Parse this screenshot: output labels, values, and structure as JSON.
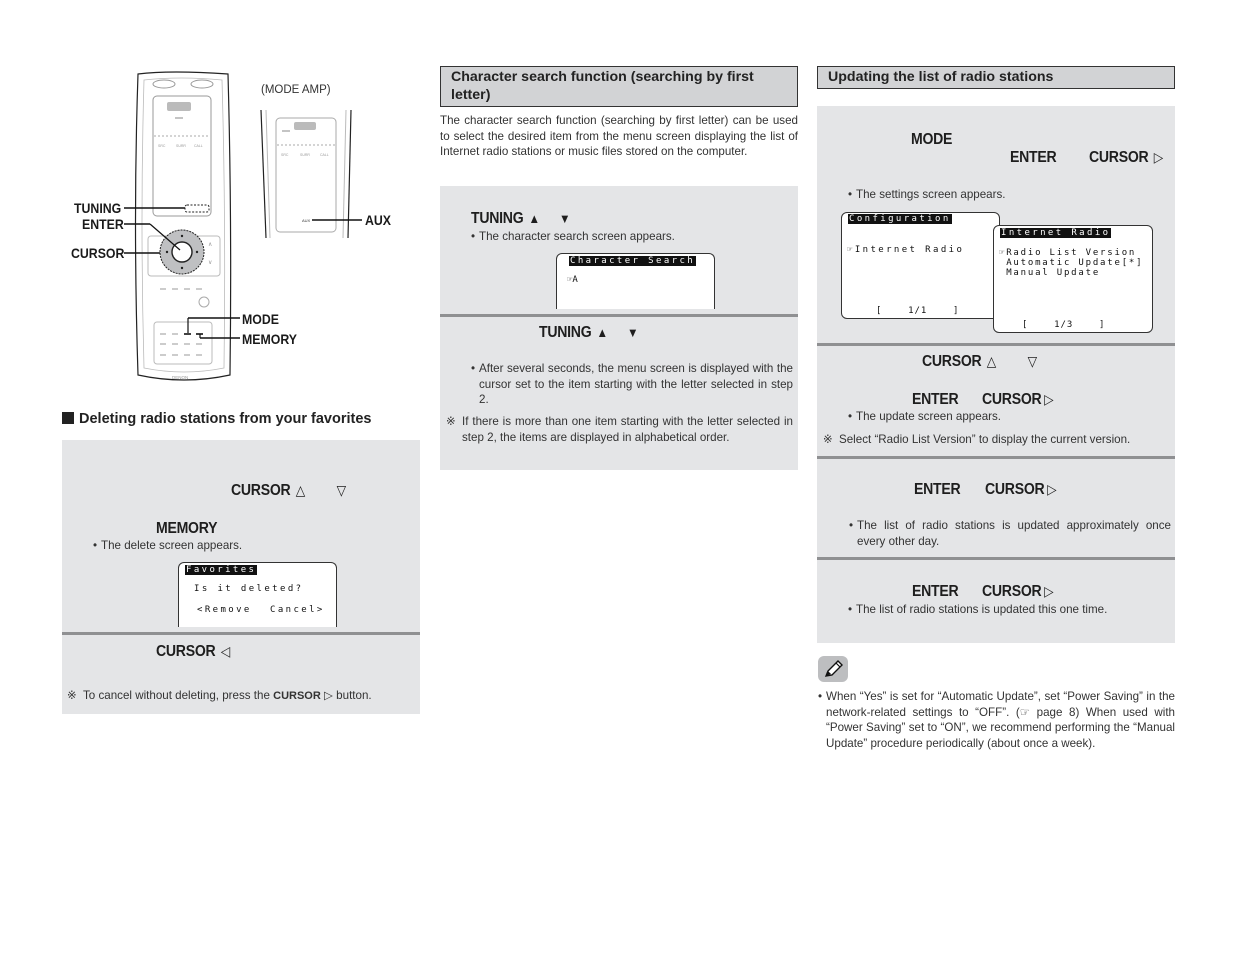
{
  "figure": {
    "remote_labels": {
      "tuning": "TUNING",
      "enter": "ENTER",
      "cursor": "CURSOR",
      "mode": "MODE",
      "memory": "MEMORY",
      "aux": "AUX",
      "brand": "DENON"
    },
    "mode_amp_caption": "(MODE AMP)"
  },
  "left_column": {
    "heading": "Deleting radio stations from your favorites",
    "step1": {
      "keyword": "CURSOR",
      "symbol_up": "△",
      "symbol_down": "▽"
    },
    "step2": {
      "keyword": "MEMORY",
      "bullet": "The delete screen appears."
    },
    "delete_screen": {
      "title": "Favorites",
      "line1": "Is it deleted?",
      "option_left": "<Remove",
      "option_right": "Cancel>"
    },
    "step3": {
      "keyword": "CURSOR",
      "symbol": "◁"
    },
    "note": {
      "mark": "※",
      "text_before": "To cancel without deleting, press the ",
      "keyword": "CURSOR",
      "symbol": "▷",
      "text_after": " button."
    }
  },
  "middle_column": {
    "heading": "Character search function (searching by first letter)",
    "intro": "The character search function (searching by first letter) can be used to select the desired item from the menu screen displaying the list of Internet radio stations or music files stored on the computer.",
    "step1": {
      "keyword": "TUNING",
      "symbol_up": "▲",
      "symbol_down": "▼",
      "bullet": "The character search screen appears."
    },
    "search_screen": {
      "title": "Character Search",
      "line1": "☞A"
    },
    "step2": {
      "keyword": "TUNING",
      "symbol_up": "▲",
      "symbol_down": "▼",
      "bullet": "After several seconds, the menu screen is displayed with the cursor set to the item starting with the letter selected in step 2."
    },
    "note": {
      "mark": "※",
      "text": "If there is more than one item starting with the letter selected in step 2, the items are displayed in alphabetical order."
    }
  },
  "right_column": {
    "heading": "Updating the list of radio stations",
    "step1": {
      "keyword_mode": "MODE",
      "keyword_enter": "ENTER",
      "keyword_cursor": "CURSOR",
      "symbol": "▷",
      "bullet": "The settings screen appears."
    },
    "config_screen": {
      "title": "Configuration",
      "line1": "☞Internet Radio",
      "page": "[    1/1    ]"
    },
    "radio_screen": {
      "title": "Internet Radio",
      "line1": "☞Radio List Version",
      "line2": " Automatic Update[*]",
      "line3": " Manual Update",
      "page": "[    1/3    ]"
    },
    "step2": {
      "keyword": "CURSOR",
      "symbol_up": "△",
      "symbol_down": "▽",
      "keyword_enter": "ENTER",
      "keyword_cursor": "CURSOR",
      "symbol_right": "▷",
      "bullet": "The update screen appears.",
      "note_mark": "※",
      "note": "Select “Radio List Version” to display the current version."
    },
    "step3": {
      "keyword_enter": "ENTER",
      "keyword_cursor": "CURSOR",
      "symbol_right": "▷",
      "bullet": "The list of radio stations is updated approximately once every other day."
    },
    "step4": {
      "keyword_enter": "ENTER",
      "keyword_cursor": "CURSOR",
      "symbol_right": "▷",
      "bullet": "The list of radio stations is updated this one time."
    },
    "memo": {
      "text_part1": "When “Yes” is set for “Automatic Update”, set “Power Saving” in the network-related settings to “OFF”. (",
      "ref_icon": "☞",
      "text_ref": " page 8)",
      "text_part2": " When used with “Power Saving” set to “ON”, we recommend performing the “Manual Update” procedure periodically (about once a week)."
    }
  }
}
